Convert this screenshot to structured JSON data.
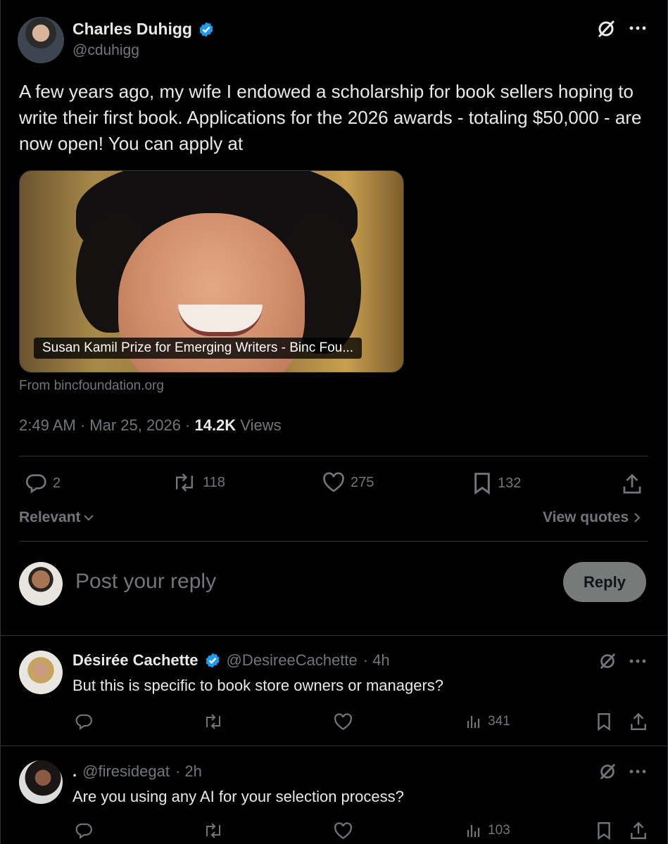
{
  "tweet": {
    "author_name": "Charles Duhigg",
    "author_handle": "@cduhigg",
    "text": "A few years ago, my wife I endowed a scholarship for book sellers hoping to write their first book. Applications for the 2026 awards - totaling $50,000 - are now open! You can apply at",
    "card_title": "Susan Kamil Prize for Emerging Writers - Binc Fou...",
    "card_source": "From bincfoundation.org",
    "time": "2:49 AM · Mar 25, 2026 · ",
    "views_count": "14.2K",
    "views_label": " Views",
    "stats": {
      "replies": "2",
      "reposts": "118",
      "likes": "275",
      "bookmarks": "132"
    }
  },
  "sort": {
    "label": "Relevant",
    "view_quotes": "View quotes"
  },
  "composer": {
    "placeholder": "Post your reply",
    "button": "Reply"
  },
  "replies": [
    {
      "name": "Désirée Cachette",
      "handle": "@DesireeCachette",
      "time": "· 4h",
      "text": "But this is specific to book store owners or managers?",
      "views": "341"
    },
    {
      "name": ".",
      "handle": "@firesidegat",
      "time": "· 2h",
      "text": "Are you using any AI for your selection process?",
      "views": "103"
    }
  ],
  "colors": {
    "background": "#000000",
    "text": "#e7e9ea",
    "muted": "#71767b",
    "verified": "#1d9bf0",
    "divider": "#2f3336"
  },
  "icons": [
    "verified-badge-icon",
    "grok-icon",
    "more-icon",
    "reply-icon",
    "repost-icon",
    "like-icon",
    "bookmark-icon",
    "share-icon",
    "chevron-down-icon",
    "chevron-right-icon",
    "views-icon"
  ]
}
